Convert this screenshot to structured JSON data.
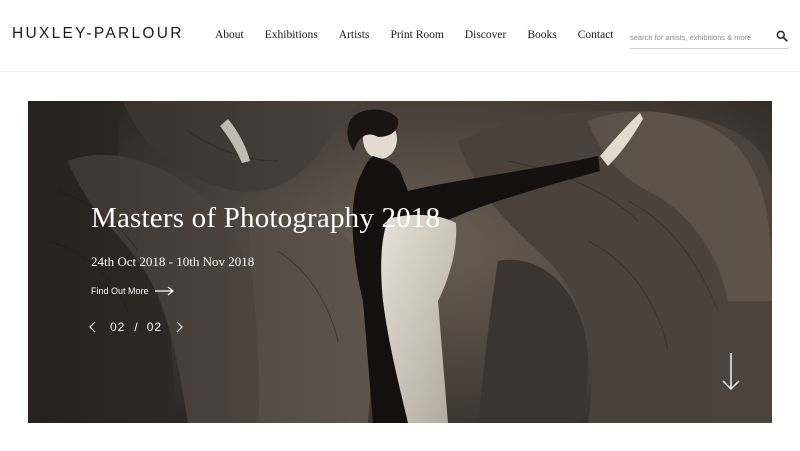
{
  "brand": {
    "logo": "HUXLEY-PARLOUR"
  },
  "nav": {
    "items": [
      {
        "label": "About"
      },
      {
        "label": "Exhibitions"
      },
      {
        "label": "Artists"
      },
      {
        "label": "Print Room"
      },
      {
        "label": "Discover"
      },
      {
        "label": "Books"
      },
      {
        "label": "Contact"
      }
    ]
  },
  "search": {
    "placeholder": "search for artists, exhibitions & more",
    "value": "",
    "icon": "search-icon"
  },
  "hero": {
    "title": "Masters of Photography 2018",
    "dates": "24th Oct 2018 - 10th Nov 2018",
    "cta_label": "Find Out More",
    "cta_icon": "arrow-right-icon",
    "pager": {
      "current": "02",
      "separator": "/",
      "total": "02"
    },
    "scroll_icon": "arrow-down-icon"
  },
  "colors": {
    "hero_text": "#ffffff",
    "header_bg": "#ffffff",
    "text": "#1a1a1a"
  }
}
